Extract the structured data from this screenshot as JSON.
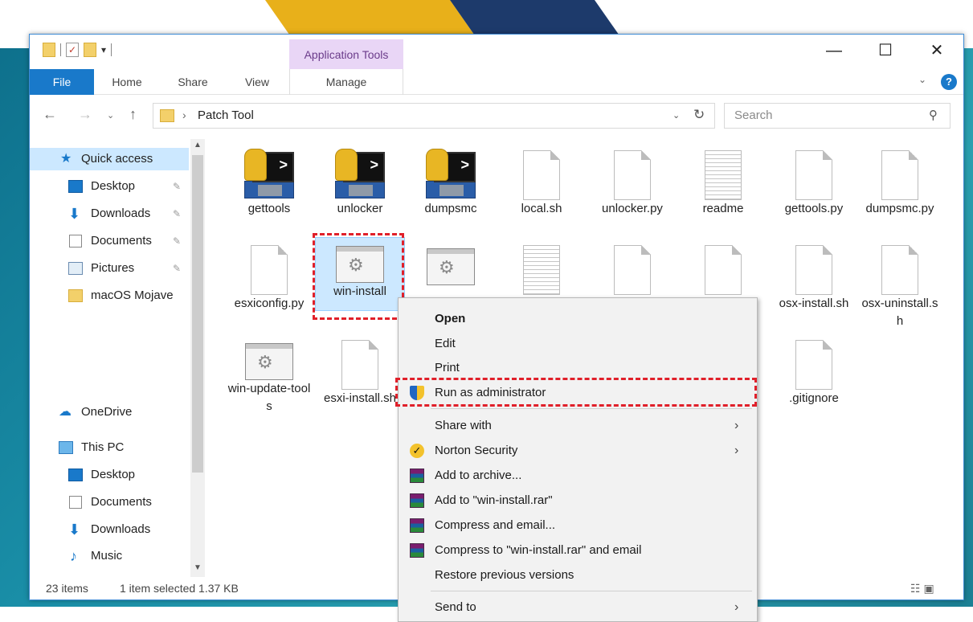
{
  "window": {
    "quick_access_dropdown": "▾",
    "contextual_group": "Application Tools",
    "controls": {
      "minimize": "—",
      "maximize": "☐",
      "close": "✕"
    }
  },
  "ribbon": {
    "tabs": [
      "File",
      "Home",
      "Share",
      "View",
      "Manage"
    ],
    "collapse": "⌄",
    "help": "?"
  },
  "address": {
    "back": "←",
    "forward": "→",
    "recent": "⌄",
    "up": "↑",
    "separator": "›",
    "path": "Patch Tool",
    "dropdown": "⌄",
    "refresh": "↻",
    "search_placeholder": "Search",
    "search_glyph": "⚲"
  },
  "sidebar": {
    "scroll_up": "▲",
    "scroll_down": "▼",
    "pin_glyph": "✎",
    "items": [
      {
        "label": "Quick access",
        "icon": "star-icon"
      },
      {
        "label": "Desktop",
        "icon": "desktop-icon"
      },
      {
        "label": "Downloads",
        "icon": "downloads-icon"
      },
      {
        "label": "Documents",
        "icon": "documents-icon"
      },
      {
        "label": "Pictures",
        "icon": "pictures-icon"
      },
      {
        "label": "macOS Mojave ",
        "icon": "folder-icon"
      },
      {
        "label": "OneDrive",
        "icon": "cloud-icon"
      },
      {
        "label": "This PC",
        "icon": "computer-icon"
      },
      {
        "label": "Desktop",
        "icon": "desktop-icon"
      },
      {
        "label": "Documents",
        "icon": "documents-icon"
      },
      {
        "label": "Downloads",
        "icon": "downloads-icon"
      },
      {
        "label": "Music",
        "icon": "music-icon"
      }
    ]
  },
  "files": [
    {
      "name": "gettools",
      "type": "python-exe"
    },
    {
      "name": "unlocker",
      "type": "python-exe"
    },
    {
      "name": "dumpsmc",
      "type": "python-exe"
    },
    {
      "name": "local.sh",
      "type": "blank"
    },
    {
      "name": "unlocker.py",
      "type": "blank"
    },
    {
      "name": "readme",
      "type": "text"
    },
    {
      "name": "gettools.py",
      "type": "blank"
    },
    {
      "name": "dumpsmc.py",
      "type": "blank"
    },
    {
      "name": "esxiconfig.py",
      "type": "blank"
    },
    {
      "name": "win-install",
      "type": "batch",
      "selected": true
    },
    {
      "name": "",
      "type": "batch"
    },
    {
      "name": "",
      "type": "text"
    },
    {
      "name": "",
      "type": "blank"
    },
    {
      "name": "",
      "type": "blank"
    },
    {
      "name": "osx-install.sh",
      "type": "blank"
    },
    {
      "name": "osx-uninstall.sh",
      "type": "blank"
    },
    {
      "name": "win-update-tools",
      "type": "batch"
    },
    {
      "name": "esxi-install.sh",
      "type": "blank"
    },
    {
      "name": ".gitignore",
      "type": "blank"
    }
  ],
  "context_menu": {
    "items": [
      {
        "label": "Open",
        "bold": true
      },
      {
        "label": "Edit"
      },
      {
        "label": "Print"
      },
      {
        "label": "Run as administrator",
        "icon": "uac-shield-icon"
      },
      {
        "label": "Share with",
        "submenu": true
      },
      {
        "label": "Norton Security",
        "icon": "norton-icon",
        "submenu": true
      },
      {
        "label": "Add to archive...",
        "icon": "winrar-icon"
      },
      {
        "label": "Add to \"win-install.rar\"",
        "icon": "winrar-icon"
      },
      {
        "label": "Compress and email...",
        "icon": "winrar-icon"
      },
      {
        "label": "Compress to \"win-install.rar\" and email",
        "icon": "winrar-icon"
      },
      {
        "label": "Restore previous versions"
      },
      {
        "label": "Send to",
        "submenu": true
      }
    ],
    "submenu_arrow": "›",
    "norton_glyph": "✓"
  },
  "status": {
    "count": "23 items",
    "selection": "1 item selected  1.37 KB",
    "view_glyphs": "☷ ▣"
  },
  "colors": {
    "accent": "#1979ca",
    "selection": "#cce8ff",
    "highlight": "#e0202a",
    "app_tools": "#e9d6f6"
  }
}
